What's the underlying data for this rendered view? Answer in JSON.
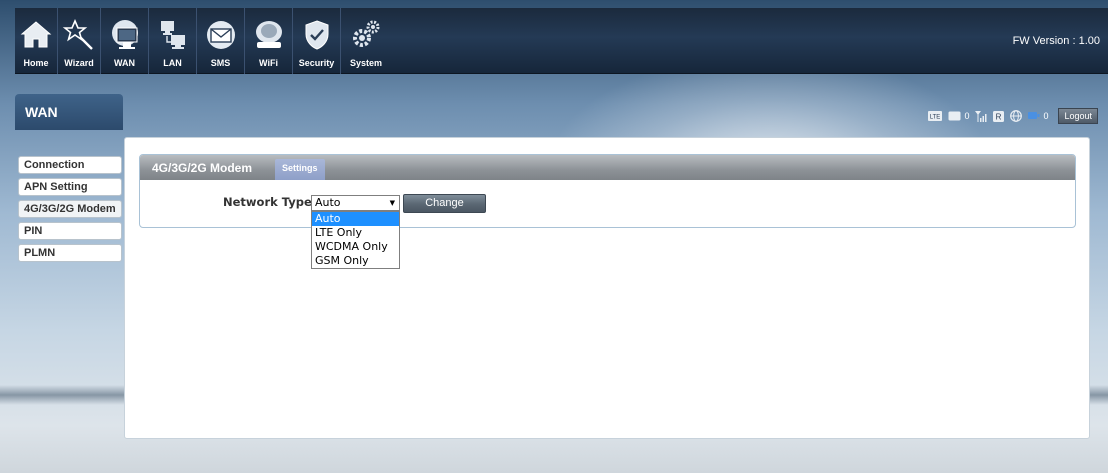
{
  "nav": {
    "items": [
      {
        "label": "Home",
        "icon": "home-icon"
      },
      {
        "label": "Wizard",
        "icon": "wand-icon"
      },
      {
        "label": "WAN",
        "icon": "globe-monitor-icon"
      },
      {
        "label": "LAN",
        "icon": "lan-computers-icon"
      },
      {
        "label": "SMS",
        "icon": "envelope-icon"
      },
      {
        "label": "WiFi",
        "icon": "wifi-router-icon"
      },
      {
        "label": "Security",
        "icon": "shield-icon"
      },
      {
        "label": "System",
        "icon": "gears-icon"
      }
    ],
    "fw_version": "FW Version : 1.00"
  },
  "page": {
    "title": "WAN"
  },
  "status": {
    "sms_count": "0",
    "wifi_count": "0",
    "logout_label": "Logout",
    "badge_text": "LTE",
    "r_text": "R"
  },
  "sidebar": {
    "items": [
      {
        "label": "Connection"
      },
      {
        "label": "APN Setting"
      },
      {
        "label": "4G/3G/2G Modem"
      },
      {
        "label": "PIN"
      },
      {
        "label": "PLMN"
      }
    ]
  },
  "panel": {
    "title": "4G/3G/2G Modem",
    "tab_label": "Settings",
    "network_type_label": "Network Type",
    "network_type_value": "Auto",
    "change_label": "Change",
    "options": [
      "Auto",
      "LTE Only",
      "WCDMA Only",
      "GSM Only"
    ]
  },
  "colors": {
    "topbar": "#1b2a3d",
    "accent": "#1e90ff",
    "settings_tab": "#8e9fc8"
  }
}
